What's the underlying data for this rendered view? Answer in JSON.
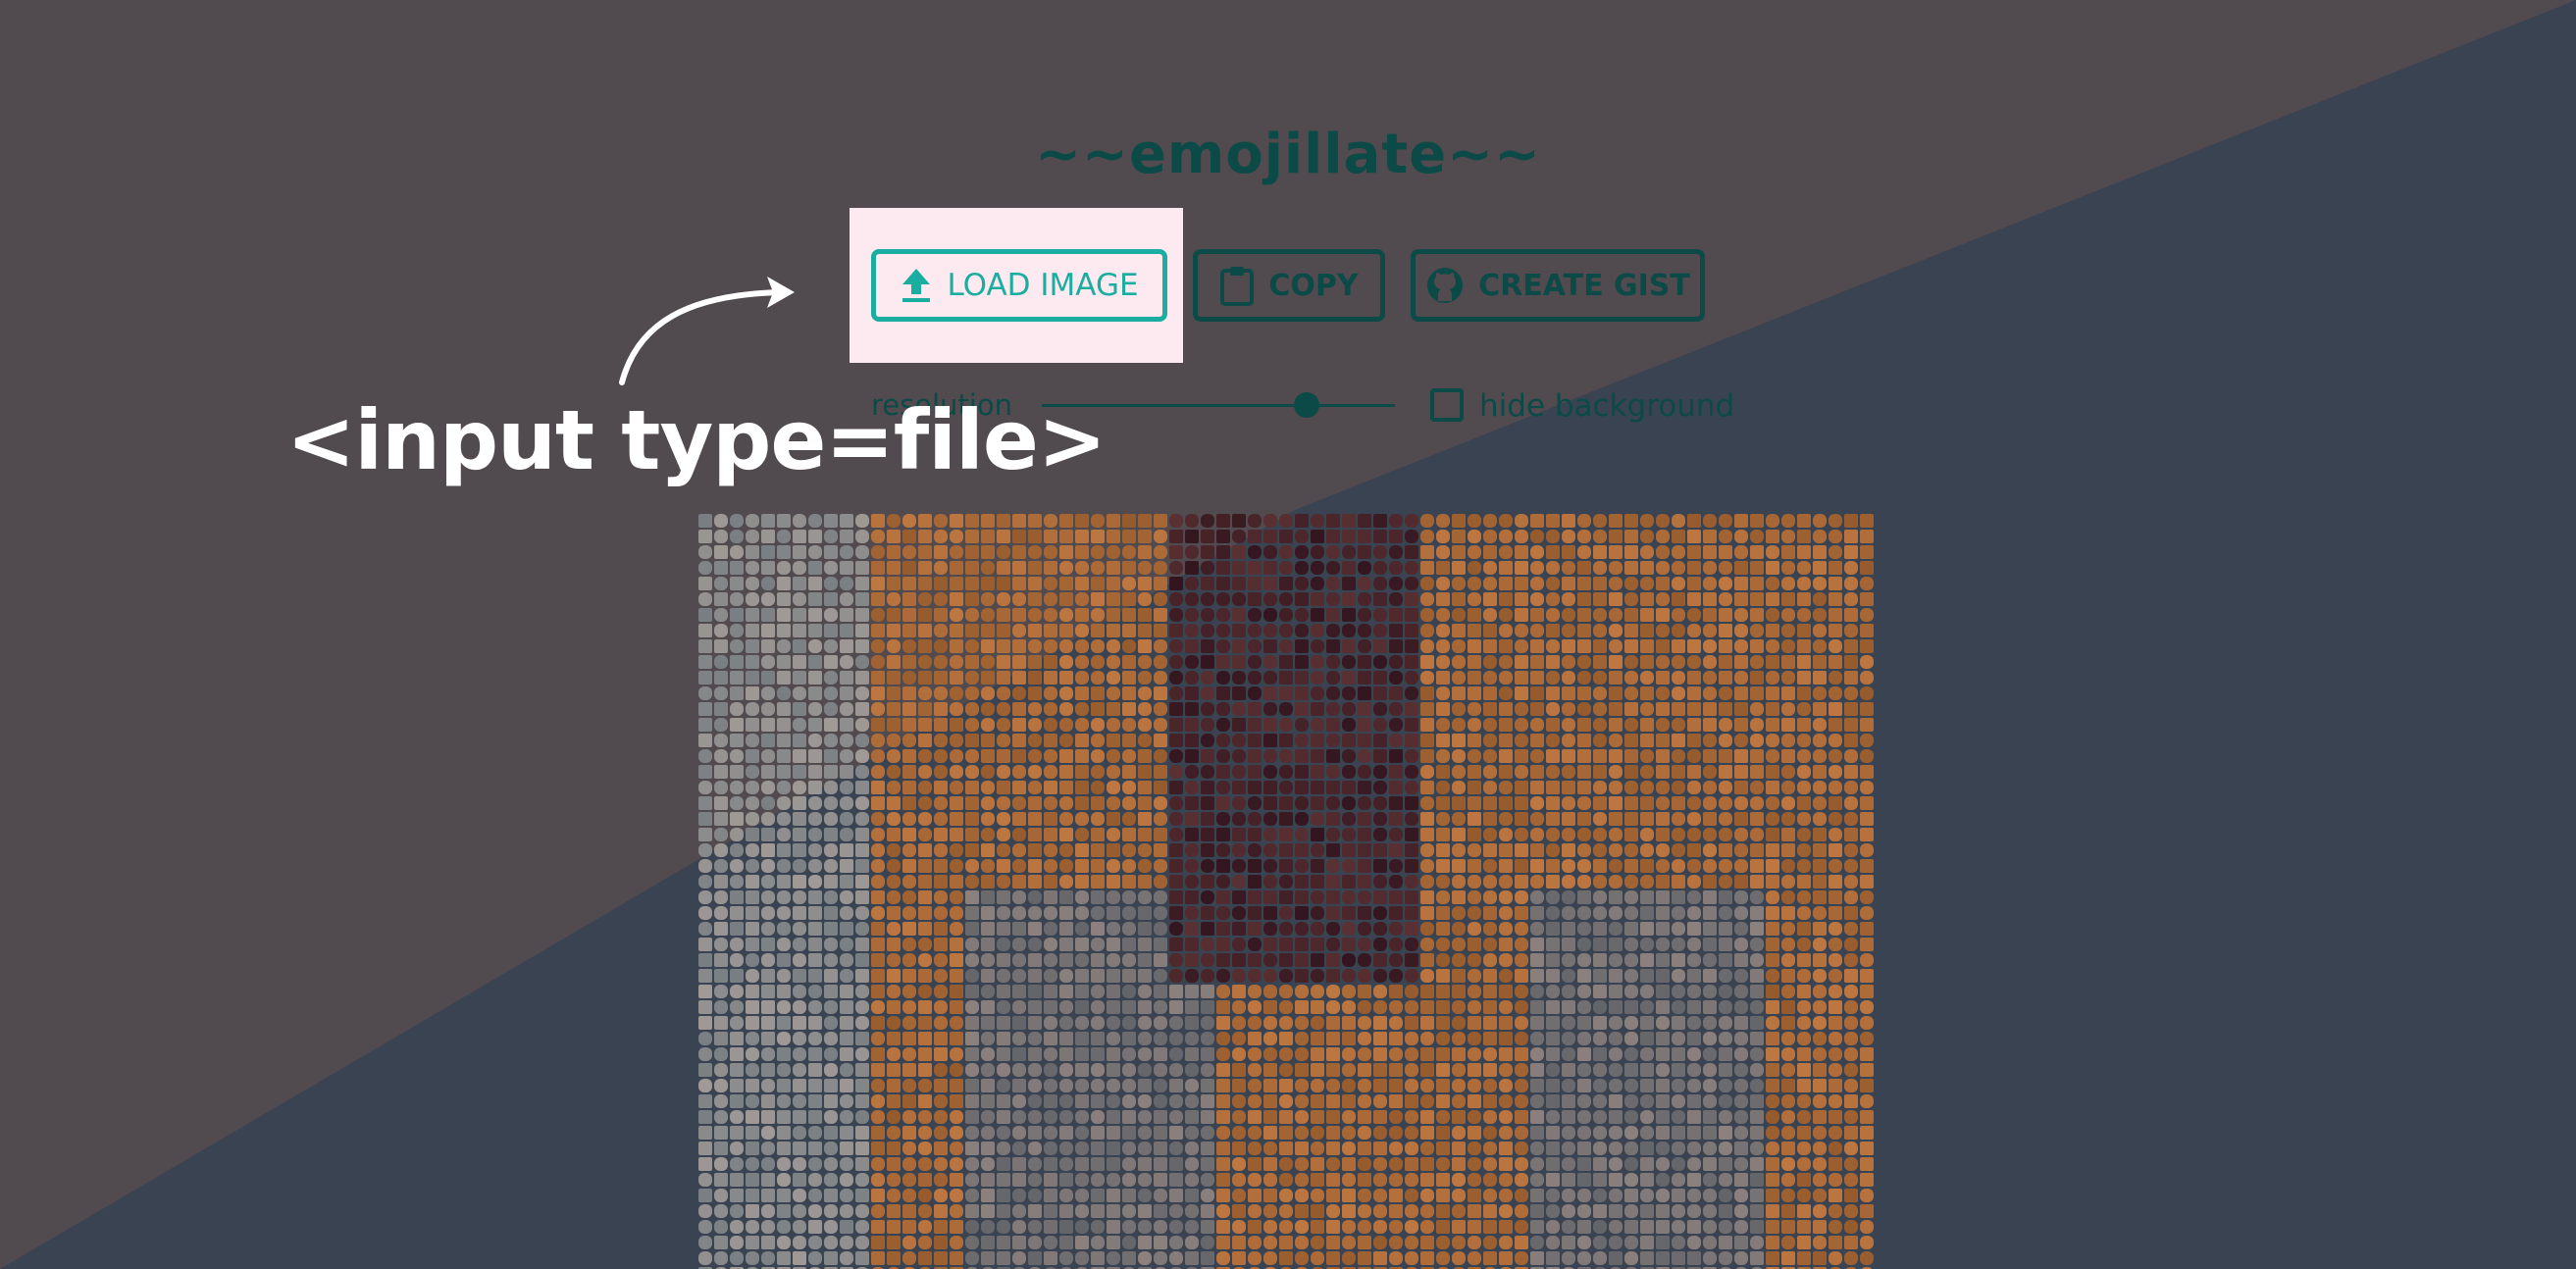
{
  "app": {
    "title": "~~emojillate~~"
  },
  "toolbar": {
    "load_label": "LOAD IMAGE",
    "copy_label": "COPY",
    "gist_label": "CREATE GIST"
  },
  "icons": {
    "load": "upload-icon",
    "copy": "clipboard-icon",
    "gist": "github-icon"
  },
  "controls": {
    "resolution_label": "resolution",
    "resolution_value": 0.75,
    "hide_background_label": "hide background",
    "hide_background_checked": false
  },
  "annotation": {
    "text": "<input type=file>"
  },
  "colors": {
    "bg_dark": "#514a4f",
    "bg_slate": "#3a4352",
    "accent": "#1aaea0",
    "text_dark": "#0b4a47",
    "highlight": "#fdeaf0"
  }
}
